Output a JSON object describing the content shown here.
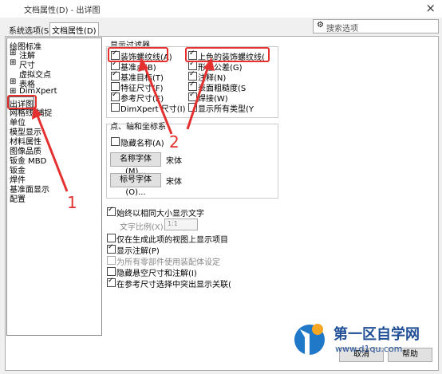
{
  "window": {
    "title": "文档属性(D) - 出详图",
    "close": "×"
  },
  "tabs": [
    {
      "label": "系统选项(S)"
    },
    {
      "label": "文档属性(D)"
    }
  ],
  "search": {
    "placeholder": "搜索选项"
  },
  "tree": [
    "绘图标准",
    "注解",
    "尺寸",
    "虚拟交点",
    "表格",
    "DimXpert",
    "出详图",
    "网格线/捕捉",
    "单位",
    "模型显示",
    "材料属性",
    "图像品质",
    "钣金 MBD",
    "钣金",
    "焊件",
    "基准面显示",
    "配置"
  ],
  "filter": {
    "title": "显示过滤器",
    "left": [
      {
        "label": "装饰螺纹线(A)",
        "checked": true
      },
      {
        "label": "基准点(B)",
        "checked": true
      },
      {
        "label": "基准目标(T)",
        "checked": true
      },
      {
        "label": "特征尺寸(F)",
        "checked": false
      },
      {
        "label": "参考尺寸(E)",
        "checked": true
      },
      {
        "label": "DimXpert 尺寸(I)",
        "checked": false
      }
    ],
    "right": [
      {
        "label": "上色的装饰螺纹线(",
        "checked": true
      },
      {
        "label": "形位公差(G)",
        "checked": true
      },
      {
        "label": "注释(N)",
        "checked": true
      },
      {
        "label": "表面粗糙度(S",
        "checked": true
      },
      {
        "label": "焊接(W)",
        "checked": true
      },
      {
        "label": "显示所有类型(Y",
        "checked": false
      }
    ]
  },
  "pa": {
    "title": "点、轴和坐标系",
    "hide_name": "隐藏名称(A)",
    "name_font_btn": "名称字体(M)...",
    "name_font": "宋体",
    "label_font_btn": "标号字体(O)...",
    "label_font": "宋体"
  },
  "opts": [
    {
      "label": "始终以相同大小显示文字",
      "checked": true,
      "dim": false
    },
    {
      "label": "文字比例(X):",
      "checked": null,
      "dim": true
    },
    {
      "label": "仅在生成此项的视图上显示项目",
      "checked": false,
      "dim": false
    },
    {
      "label": "显示注解(P)",
      "checked": true,
      "dim": false
    },
    {
      "label": "为所有零部件使用装配体设定",
      "checked": false,
      "dim": true
    },
    {
      "label": "隐藏悬空尺寸和注解(I)",
      "checked": false,
      "dim": false
    },
    {
      "label": "在参考尺寸选择中突出显示关联(",
      "checked": true,
      "dim": false
    }
  ],
  "scale_value": "1:1",
  "buttons": {
    "cancel": "取消",
    "help": "帮助"
  },
  "annotations": {
    "n1": "1",
    "n2": "2"
  },
  "watermark": {
    "name": "第一区自学网",
    "url": "www.d1qu.com"
  }
}
